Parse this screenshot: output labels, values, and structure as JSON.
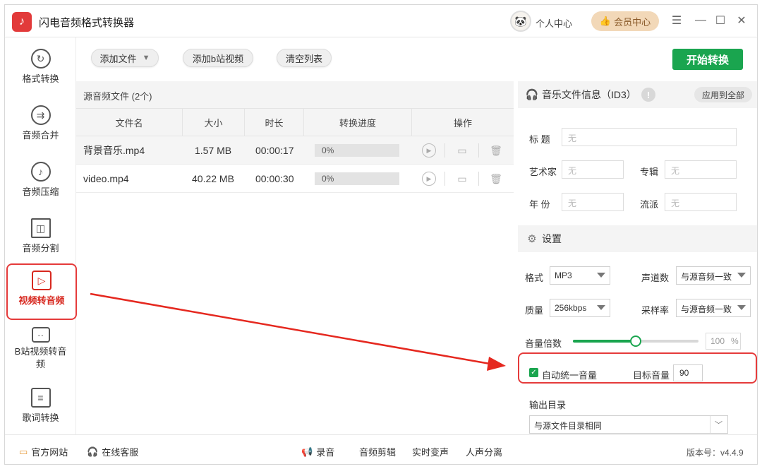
{
  "app": {
    "title": "闪电音频格式转换器",
    "user_center": "个人中心",
    "vip_center": "会员中心"
  },
  "sidebar": {
    "items": [
      {
        "label": "格式转换",
        "icon": "refresh-icon"
      },
      {
        "label": "音频合并",
        "icon": "merge-icon"
      },
      {
        "label": "音频压缩",
        "icon": "music-note-icon"
      },
      {
        "label": "音频分割",
        "icon": "split-icon"
      },
      {
        "label": "视频转音频",
        "icon": "video-to-audio-icon",
        "active": true
      },
      {
        "label": "B站视频转音频",
        "icon": "bilibili-icon"
      },
      {
        "label": "歌词转换",
        "icon": "lyrics-icon"
      }
    ]
  },
  "toolbar": {
    "add_file": "添加文件",
    "add_bilibili": "添加b站视频",
    "clear_list": "清空列表",
    "start": "开始转换"
  },
  "file_list": {
    "header": "源音频文件 (2个)",
    "columns": [
      "文件名",
      "大小",
      "时长",
      "转换进度",
      "操作"
    ],
    "rows": [
      {
        "name": "背景音乐.mp4",
        "size": "1.57 MB",
        "duration": "00:00:17",
        "progress": "0%"
      },
      {
        "name": "video.mp4",
        "size": "40.22 MB",
        "duration": "00:00:30",
        "progress": "0%"
      }
    ]
  },
  "id3": {
    "title": "音乐文件信息（ID3）",
    "apply_all": "应用到全部",
    "fields": {
      "title_label": "标  题",
      "artist_label": "艺术家",
      "album_label": "专辑",
      "year_label": "年  份",
      "genre_label": "流派",
      "placeholder": "无"
    }
  },
  "settings": {
    "title": "设置",
    "format_label": "格式",
    "format_value": "MP3",
    "channels_label": "声道数",
    "channels_value": "与源音频一致",
    "quality_label": "质量",
    "quality_value": "256kbps",
    "samplerate_label": "采样率",
    "samplerate_value": "与源音频一致",
    "volume_label": "音量倍数",
    "volume_value": "100",
    "volume_unit": "%",
    "volume_fraction": 0.5,
    "auto_volume_label": "自动统一音量",
    "auto_volume_checked": true,
    "target_volume_label": "目标音量",
    "target_volume_value": "90",
    "output_dir_label": "输出目录",
    "output_dir_value": "与源文件目录相同"
  },
  "bottom": {
    "website": "官方网站",
    "support": "在线客服",
    "record": "录音",
    "edit": "音频剪辑",
    "voice_change": "实时变声",
    "vocal_split": "人声分离",
    "version": "版本号：v4.4.9"
  }
}
